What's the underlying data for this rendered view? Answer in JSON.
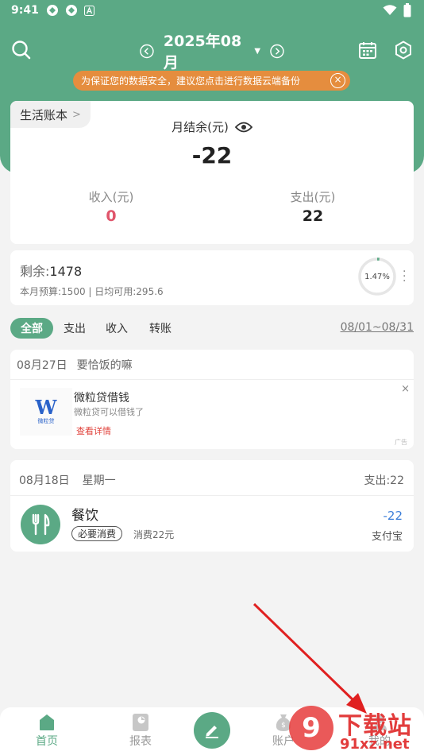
{
  "status_bar": {
    "time": "9:41"
  },
  "header": {
    "month": "2025年08月",
    "notice": "为保证您的数据安全，建议您点击进行数据云端备份",
    "notice_close": "×"
  },
  "summary": {
    "book_name": "生活账本",
    "book_chevron": ">",
    "balance_label": "月结余(元)",
    "balance_value": "-22",
    "income_label": "收入(元)",
    "income_value": "0",
    "expense_label": "支出(元)",
    "expense_value": "22"
  },
  "budget": {
    "remaining_label": "剩余:",
    "remaining_value": "1478",
    "detail": "本月预算:1500 | 日均可用:295.6",
    "percent_text": "1.47%",
    "percent_used": 1.47,
    "more": "⋮"
  },
  "filters": {
    "tabs": [
      "全部",
      "支出",
      "收入",
      "转账"
    ],
    "active_index": 0,
    "date_range": "08/01~08/31"
  },
  "ad": {
    "date": "08月27日",
    "title_note": "要恰饭的嘛",
    "logo_letter": "W",
    "logo_sub": "微粒贷",
    "name": "微粒贷借钱",
    "desc": "微粒贷可以借钱了",
    "link": "查看详情",
    "close": "×",
    "badge": "广告"
  },
  "transactions": {
    "date": "08月18日",
    "weekday": "星期一",
    "total": "支出:22",
    "items": [
      {
        "category": "餐饮",
        "tag": "必要消费",
        "note": "消费22元",
        "amount": "-22",
        "account": "支付宝"
      }
    ]
  },
  "bottom_nav": {
    "items": [
      {
        "label": "首页"
      },
      {
        "label": "报表"
      },
      {
        "label": "账户"
      },
      {
        "label": "我的"
      }
    ]
  },
  "watermark": {
    "top": "下载站",
    "bottom": "91xz.net",
    "circle": "9"
  },
  "colors": {
    "brand_green": "#5ba985",
    "notice_orange": "#e58d3e",
    "income_red": "#e0556b",
    "expense_blue": "#3d7fd9",
    "arrow_red": "#e02020"
  }
}
